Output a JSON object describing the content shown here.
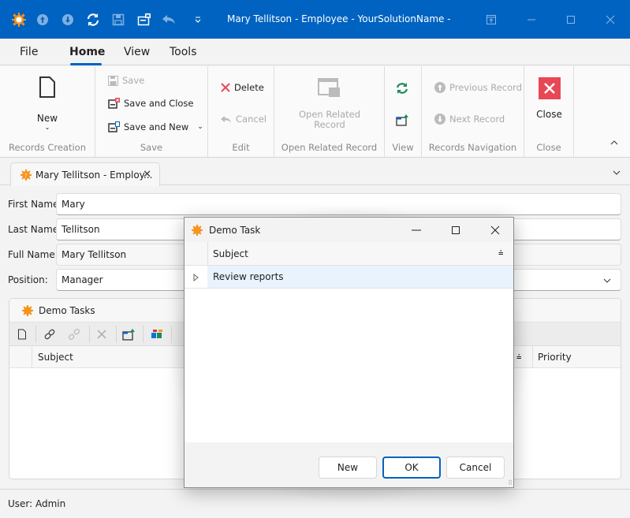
{
  "window": {
    "title": "Mary Tellitson - Employee - YourSolutionName -",
    "quick_access": [
      "app-logo-icon",
      "previous-record-icon",
      "next-record-icon",
      "refresh-icon",
      "save-icon",
      "save-and-close-icon",
      "undo-icon",
      "customize-quick-access-icon"
    ],
    "controls": [
      "restore-ribbon-icon",
      "minimize-icon",
      "maximize-icon",
      "close-icon"
    ]
  },
  "ribbon_tabs": [
    {
      "label": "File",
      "active": false
    },
    {
      "label": "Home",
      "active": true
    },
    {
      "label": "View",
      "active": false
    },
    {
      "label": "Tools",
      "active": false
    }
  ],
  "ribbon": {
    "records_creation": {
      "label": "Records Creation",
      "new": "New"
    },
    "save": {
      "label": "Save",
      "save": "Save",
      "save_and_close": "Save and Close",
      "save_and_new": "Save and New"
    },
    "edit": {
      "label": "Edit",
      "delete": "Delete",
      "cancel": "Cancel"
    },
    "open_related": {
      "label": "Open Related Record",
      "button": "Open Related Record"
    },
    "view": {
      "label": "View"
    },
    "navigation": {
      "label": "Records Navigation",
      "previous": "Previous Record",
      "next": "Next Record"
    },
    "close": {
      "label": "Close",
      "button": "Close"
    }
  },
  "document_tab": {
    "label": "Mary Tellitson - Employ..."
  },
  "form": {
    "first_name": {
      "label": "First Name:",
      "value": "Mary"
    },
    "last_name": {
      "label": "Last Name:",
      "value": "Tellitson"
    },
    "full_name": {
      "label": "Full Name:",
      "value": "Mary Tellitson"
    },
    "position": {
      "label": "Position:",
      "value": "Manager"
    }
  },
  "tasks": {
    "title": "Demo Tasks",
    "columns": [
      "Subject",
      "Priority"
    ]
  },
  "status": {
    "user": "User: Admin"
  },
  "dialog": {
    "title": "Demo Task",
    "column": "Subject",
    "rows": [
      "Review reports"
    ],
    "buttons": {
      "new": "New",
      "ok": "OK",
      "cancel": "Cancel"
    }
  },
  "colors": {
    "accent": "#0063c1",
    "close_red": "#e74856",
    "refresh_green": "#1e8a5c",
    "gear_orange": "#f7941d"
  }
}
